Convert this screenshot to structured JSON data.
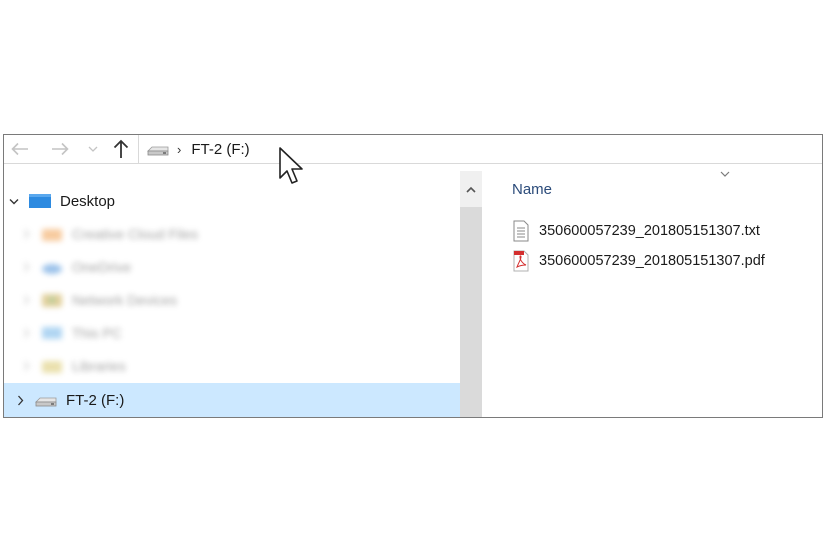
{
  "address_bar": {
    "separator": "›",
    "path": "FT-2 (F:)"
  },
  "nav_buttons": {
    "back": "back-arrow-icon",
    "forward": "forward-arrow-icon",
    "recent": "chevron-down-icon",
    "up": "up-arrow-icon"
  },
  "nav_pane": {
    "items": [
      {
        "label": "Desktop",
        "icon": "desktop-icon",
        "expanded": true
      },
      {
        "label": "Creative Cloud Files",
        "icon": "folder-icon",
        "blurred": true
      },
      {
        "label": "OneDrive",
        "icon": "onedrive-icon",
        "blurred": true
      },
      {
        "label": "Network Devices",
        "icon": "user-folder-icon",
        "blurred": true
      },
      {
        "label": "This PC",
        "icon": "pc-icon",
        "blurred": true
      },
      {
        "label": "Libraries",
        "icon": "library-icon",
        "blurred": true
      },
      {
        "label": "FT-2 (F:)",
        "icon": "drive-icon",
        "selected": true
      }
    ]
  },
  "file_list": {
    "column_name": "Name",
    "files": [
      {
        "name": "350600057239_201805151307.txt",
        "icon": "text-file-icon"
      },
      {
        "name": "350600057239_201805151307.pdf",
        "icon": "pdf-file-icon"
      }
    ]
  },
  "colors": {
    "selection": "#cce8ff",
    "header_text": "#2b4b7a",
    "desktop_blue": "#2d8ae0",
    "pdf_red": "#d32f2f"
  }
}
